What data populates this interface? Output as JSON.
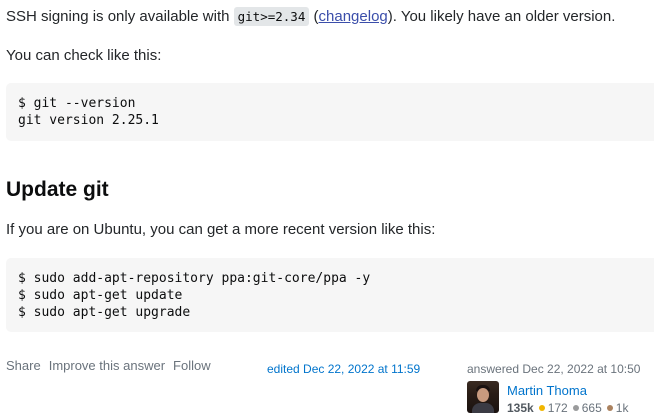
{
  "answer": {
    "para1": {
      "before": "SSH signing is only available with ",
      "code": "git>=2.34",
      "mid": " (",
      "link": "changelog",
      "after": "). You likely have an older version."
    },
    "para2": "You can check like this:",
    "code_block_1": [
      "$ git --version",
      "git version 2.25.1"
    ],
    "heading": "Update git",
    "para3": "If you are on Ubuntu, you can get a more recent version like this:",
    "code_block_2": [
      "$ sudo add-apt-repository ppa:git-core/ppa -y",
      "$ sudo apt-get update",
      "$ sudo apt-get upgrade"
    ]
  },
  "post_menu": {
    "share": "Share",
    "improve": "Improve this answer",
    "follow": "Follow"
  },
  "edited": "edited Dec 22, 2022 at 11:59",
  "answered": "answered Dec 22, 2022 at 10:50",
  "user": {
    "name": "Martin Thoma",
    "reputation": "135k",
    "badges": [
      {
        "count": "172",
        "color": "#f1b600"
      },
      {
        "count": "665",
        "color": "#9a9b9c"
      },
      {
        "count": "1k",
        "color": "#ab825f"
      }
    ]
  }
}
